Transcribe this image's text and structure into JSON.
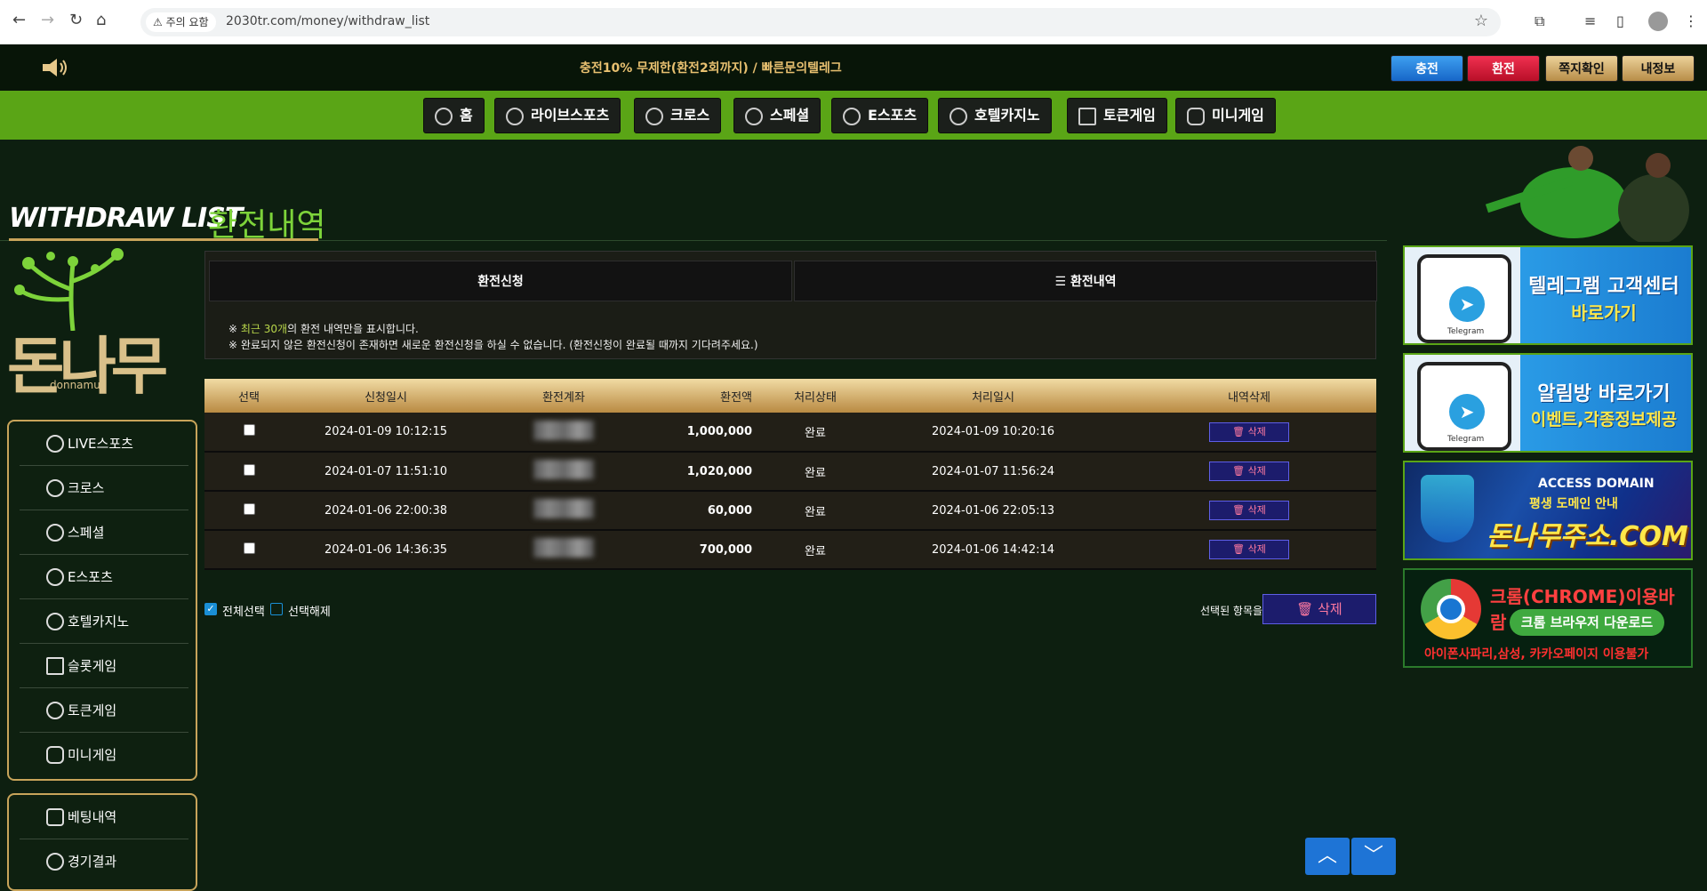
{
  "browser": {
    "warning": "주의 요함",
    "url": "2030tr.com/money/withdraw_list"
  },
  "topbar": {
    "marquee": "충전10% 무제한(환전2회까지) / 빠른문의텔레그",
    "buttons": {
      "charge": "충전",
      "exchange": "환전",
      "message": "쪽지확인",
      "myinfo": "내정보"
    }
  },
  "menu": [
    {
      "label": "홈",
      "icon": "home-icon"
    },
    {
      "label": "라이브스포츠",
      "icon": "soccer-ball-icon"
    },
    {
      "label": "크로스",
      "icon": "basketball-icon"
    },
    {
      "label": "스페셜",
      "icon": "volleyball-icon"
    },
    {
      "label": "E스포츠",
      "icon": "esports-icon"
    },
    {
      "label": "호텔카지노",
      "icon": "casino-chip-icon"
    },
    {
      "label": "토큰게임",
      "icon": "slot-icon"
    },
    {
      "label": "미니게임",
      "icon": "gamepad-icon"
    }
  ],
  "page": {
    "title_en": "WITHDRAW LIST",
    "title_ko": "환전내역"
  },
  "logo": {
    "text": "돈나무",
    "sub": "donnamu"
  },
  "sidebar": {
    "items": [
      {
        "label": "LIVE스포츠",
        "icon": "soccer-ball-icon"
      },
      {
        "label": "크로스",
        "icon": "basketball-icon"
      },
      {
        "label": "스페셜",
        "icon": "volleyball-icon"
      },
      {
        "label": "E스포츠",
        "icon": "esports-icon"
      },
      {
        "label": "호텔카지노",
        "icon": "casino-chip-icon"
      },
      {
        "label": "슬롯게임",
        "icon": "slot-icon"
      },
      {
        "label": "토큰게임",
        "icon": "token-icon"
      },
      {
        "label": "미니게임",
        "icon": "gamepad-icon"
      }
    ],
    "items2": [
      {
        "label": "베팅내역",
        "icon": "betting-icon"
      },
      {
        "label": "경기결과",
        "icon": "results-icon"
      }
    ]
  },
  "tabs": {
    "request": "환전신청",
    "history": "환전내역"
  },
  "notes": {
    "line1_prefix": "※ ",
    "line1_hl": "최근 30개",
    "line1_suffix": "의 환전 내역만을 표시합니다.",
    "line2": "※ 완료되지 않은 환전신청이 존재하면 새로운 환전신청을 하실 수 없습니다. (환전신청이 완료될 때까지 기다려주세요.)"
  },
  "table": {
    "headers": [
      "선택",
      "신청일시",
      "환전계좌",
      "환전액",
      "처리상태",
      "처리일시",
      "내역삭제"
    ],
    "delete_label": "삭제",
    "rows": [
      {
        "requested": "2024-01-09 10:12:15",
        "amount": "1,000,000",
        "status": "완료",
        "processed": "2024-01-09 10:20:16"
      },
      {
        "requested": "2024-01-07 11:51:10",
        "amount": "1,020,000",
        "status": "완료",
        "processed": "2024-01-07 11:56:24"
      },
      {
        "requested": "2024-01-06 22:00:38",
        "amount": "60,000",
        "status": "완료",
        "processed": "2024-01-06 22:05:13"
      },
      {
        "requested": "2024-01-06 14:36:35",
        "amount": "700,000",
        "status": "완료",
        "processed": "2024-01-06 14:42:14"
      }
    ]
  },
  "selection": {
    "select_all": "전체선택",
    "deselect": "선택해제",
    "selected_items": "선택된 항목을",
    "delete": "삭제"
  },
  "banners": {
    "telegram_cs": {
      "line1": "텔레그램 고객센터",
      "line2": "바로가기",
      "app": "Telegram"
    },
    "telegram_room": {
      "line1": "알림방 바로가기",
      "line2": "이벤트,각종정보제공",
      "app": "Telegram"
    },
    "domain": {
      "line1": "ACCESS DOMAIN",
      "line2": "평생 도메인 안내",
      "line3": "돈나무주소.COM"
    },
    "chrome": {
      "line1": "크롬(CHROME)이용바람",
      "line2": "크롬 브라우저 다운로드",
      "line3": "아이폰사파리,삼성, 카카오페이지 이용불가"
    }
  },
  "colors": {
    "accent_green": "#5aa516",
    "gold": "#c8a45a",
    "blue": "#1e74d6",
    "red": "#e0203c"
  }
}
